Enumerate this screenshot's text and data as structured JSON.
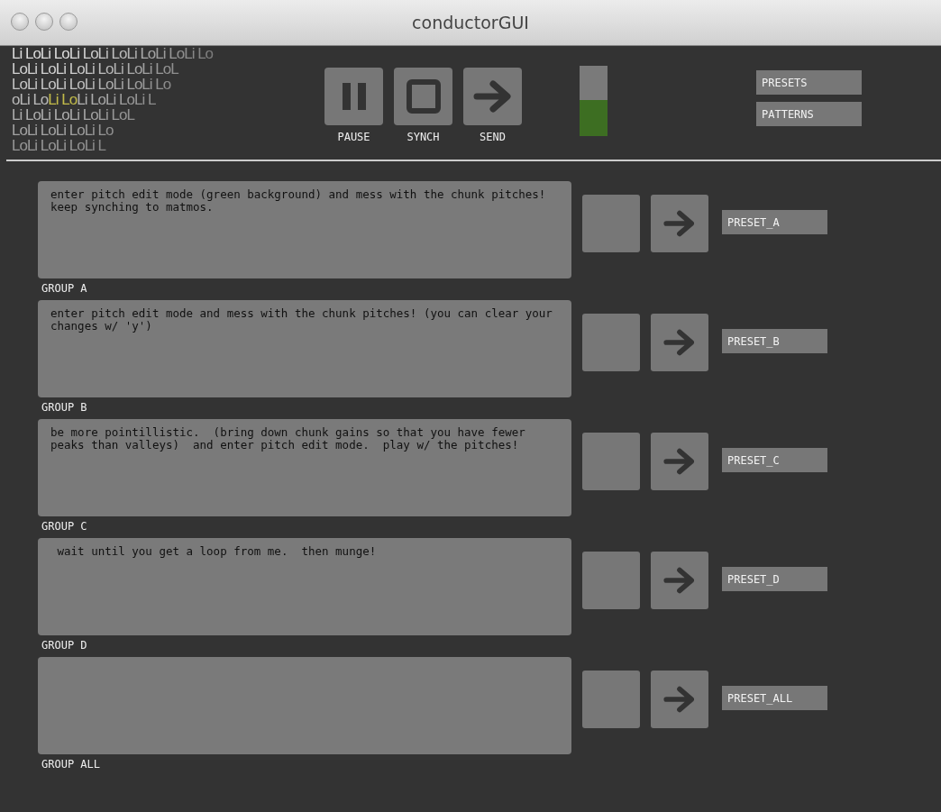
{
  "window": {
    "title": "conductorGUI"
  },
  "logo": {
    "lines": [
      [
        {
          "text": "Li LoLi LoLi LoLi LoLi LoLi LoLi Lo",
          "highlighted": false
        }
      ],
      [
        {
          "text": "LoLi LoLi LoLi LoLi LoLi LoL",
          "highlighted": false
        }
      ],
      [
        {
          "text": "LoLi LoLi LoLi LoLi LoLi Lo",
          "highlighted": false
        }
      ],
      [
        {
          "text": "oLi Lo",
          "highlighted": false
        },
        {
          "text": "Li Lo",
          "highlighted": true
        },
        {
          "text": "Li LoLi LoLi L",
          "highlighted": false
        }
      ],
      [
        {
          "text": "Li LoLi LoLi LoLi LoL",
          "highlighted": false
        }
      ],
      [
        {
          "text": "LoLi LoLi LoLi Lo",
          "highlighted": false
        }
      ],
      [
        {
          "text": "LoLi LoLi LoLi L",
          "highlighted": false
        }
      ]
    ]
  },
  "transport": [
    {
      "kind": "pause",
      "label": "PAUSE"
    },
    {
      "kind": "synch",
      "label": "SYNCH"
    },
    {
      "kind": "send",
      "label": "SEND"
    }
  ],
  "meter": {
    "level": 0.51
  },
  "menu_buttons": [
    "PRESETS",
    "PATTERNS"
  ],
  "groups": [
    {
      "label": "GROUP A",
      "text": "enter pitch edit mode (green background) and mess with the chunk pitches!  keep synching to matmos.",
      "preset": "PRESET_A"
    },
    {
      "label": "GROUP B",
      "text": "enter pitch edit mode and mess with the chunk pitches! (you can clear your changes w/ 'y')",
      "preset": "PRESET_B"
    },
    {
      "label": "GROUP C",
      "text": "be more pointillistic.  (bring down chunk gains so that you have fewer peaks than valleys)  and enter pitch edit mode.  play w/ the pitches!",
      "preset": "PRESET_C"
    },
    {
      "label": "GROUP D",
      "text": " wait until you get a loop from me.  then munge!",
      "preset": "PRESET_D"
    },
    {
      "label": "GROUP ALL",
      "preset": "PRESET_ALL"
    }
  ]
}
